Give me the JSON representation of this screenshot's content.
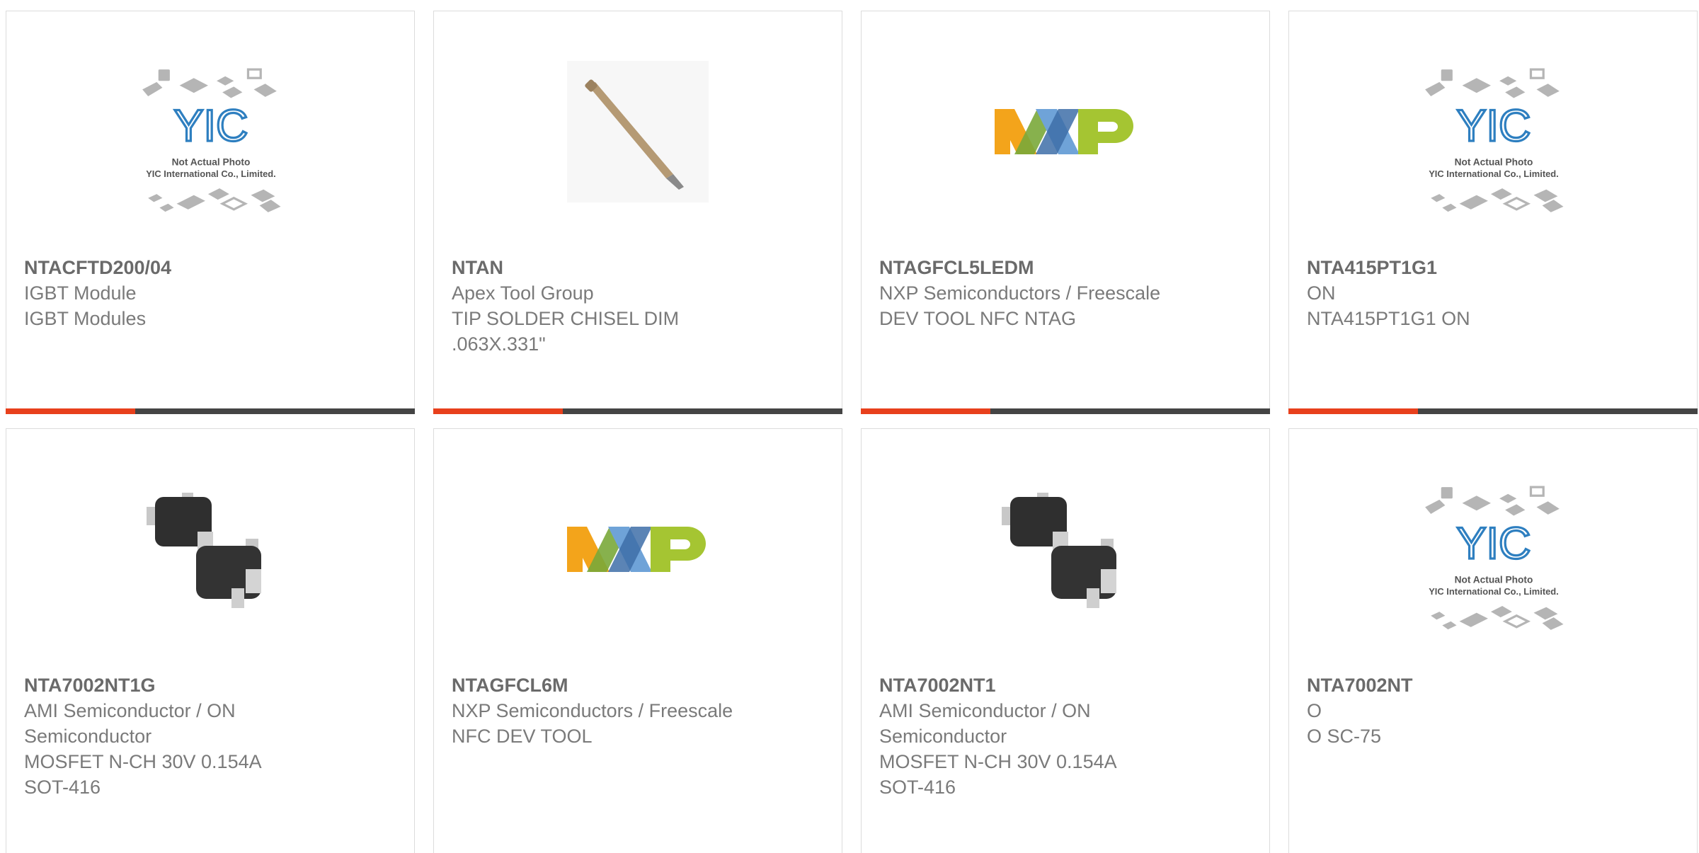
{
  "colors": {
    "accent": "#e8401c",
    "bar": "#444444",
    "border": "#dcdcdc",
    "text": "#777777"
  },
  "placeholder": {
    "line1": "Not Actual Photo",
    "line2": "YIC International Co., Limited.",
    "logo": "YIC"
  },
  "products": [
    {
      "pn": "NTACFTD200/04",
      "maker": "IGBT Module",
      "desc": "IGBT Modules",
      "desc2": "",
      "desc3": "",
      "image": "yic-placeholder-icon"
    },
    {
      "pn": "NTAN",
      "maker": "Apex Tool Group",
      "desc": "TIP SOLDER CHISEL DIM",
      "desc2": ".063X.331\"",
      "desc3": "",
      "image": "solder-tip-icon"
    },
    {
      "pn": "NTAGFCL5LEDM",
      "maker": "NXP Semiconductors / Freescale",
      "desc": "DEV TOOL NFC NTAG",
      "desc2": "",
      "desc3": "",
      "image": "nxp-logo-icon"
    },
    {
      "pn": "NTA415PT1G1",
      "maker": "ON",
      "desc": "NTA415PT1G1 ON",
      "desc2": "",
      "desc3": "",
      "image": "yic-placeholder-icon"
    },
    {
      "pn": "NTA7002NT1G",
      "maker": "AMI Semiconductor / ON",
      "desc": "Semiconductor",
      "desc2": "MOSFET N-CH 30V 0.154A",
      "desc3": "SOT-416",
      "image": "sot-chip-icon"
    },
    {
      "pn": "NTAGFCL6M",
      "maker": "NXP Semiconductors / Freescale",
      "desc": "NFC DEV TOOL",
      "desc2": "",
      "desc3": "",
      "image": "nxp-logo-icon"
    },
    {
      "pn": "NTA7002NT1",
      "maker": "AMI Semiconductor / ON",
      "desc": "Semiconductor",
      "desc2": "MOSFET N-CH 30V 0.154A",
      "desc3": "SOT-416",
      "image": "sot-chip-icon"
    },
    {
      "pn": "NTA7002NT",
      "maker": "O",
      "desc": "O SC-75",
      "desc2": "",
      "desc3": "",
      "image": "yic-placeholder-icon"
    }
  ]
}
